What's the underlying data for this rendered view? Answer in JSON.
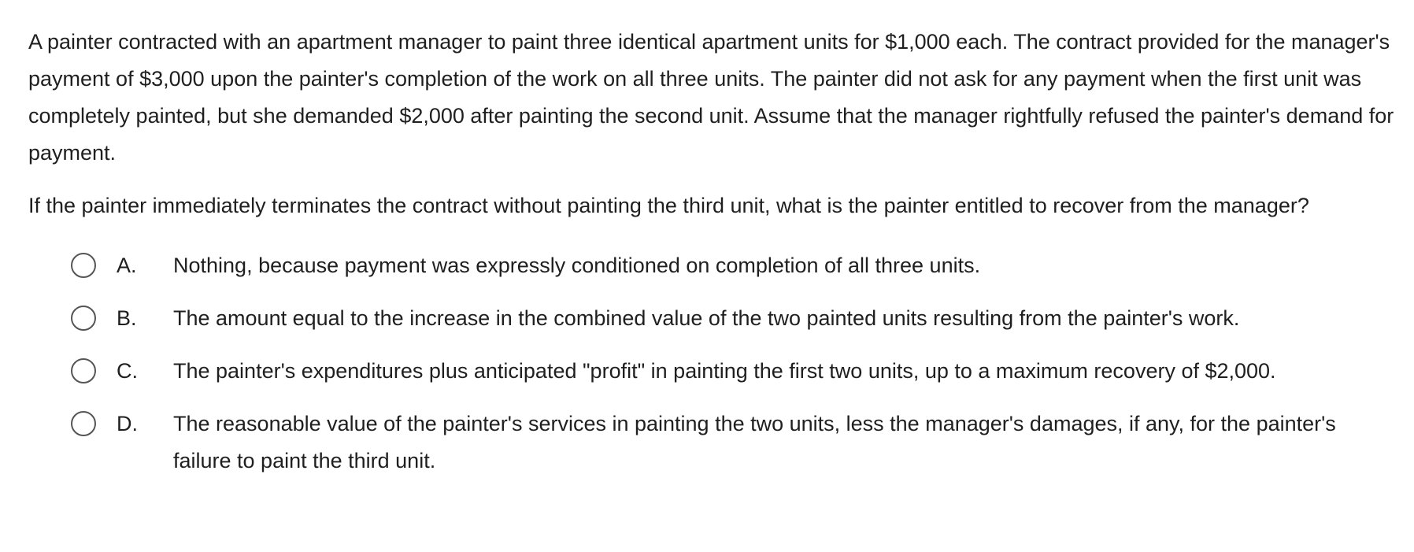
{
  "question": {
    "stem_paragraphs": [
      "A painter contracted with an apartment manager to paint three identical apartment units for $1,000 each.  The contract provided for the manager's payment of $3,000 upon the painter's completion of the work on all three units.  The painter did not ask for any payment when the first unit was completely painted, but she demanded $2,000 after painting the second unit.  Assume that the manager rightfully refused the painter's demand for payment.",
      "If the painter immediately terminates the contract without painting the third unit, what is the painter entitled to recover from the manager?"
    ],
    "options": [
      {
        "letter": "A.",
        "text": "Nothing, because payment was expressly conditioned on completion of all three units."
      },
      {
        "letter": "B.",
        "text": "The amount equal to the increase in the combined value of the two painted units resulting from the painter's work."
      },
      {
        "letter": "C.",
        "text": "The painter's expenditures plus anticipated \"profit\" in painting the first two units, up to a maximum recovery of $2,000."
      },
      {
        "letter": "D.",
        "text": "The reasonable value of the painter's services in painting the two units, less the manager's damages, if any, for the painter's failure to paint the third unit."
      }
    ]
  },
  "colors": {
    "text": "#1f1f1f",
    "radio_border": "#555555",
    "background": "#ffffff"
  },
  "icons": {
    "radio": "radio-button-unselected-icon"
  }
}
